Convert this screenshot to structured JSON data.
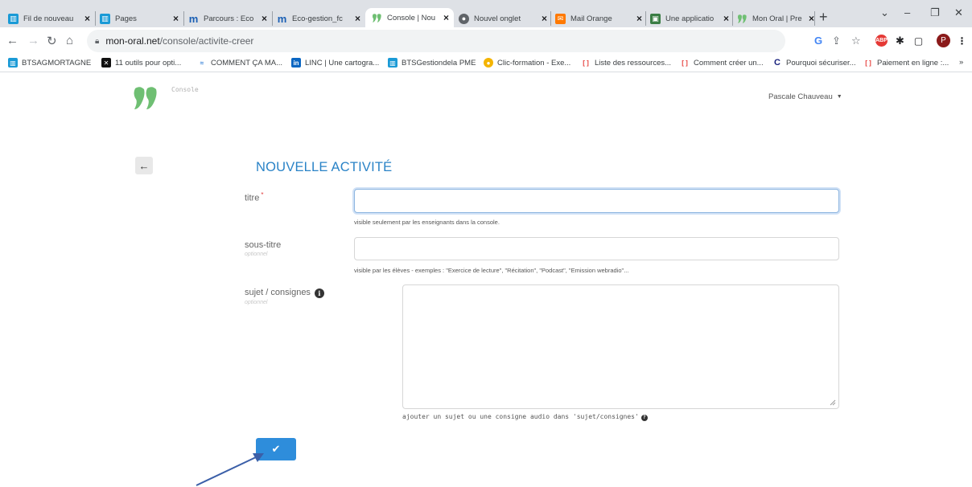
{
  "browser": {
    "tabs": [
      {
        "label": "Fil de nouveau",
        "icon": "linc-icon",
        "active": false
      },
      {
        "label": "Pages",
        "icon": "linc-icon",
        "active": false
      },
      {
        "label": "Parcours : Eco",
        "icon": "m-icon",
        "active": false
      },
      {
        "label": "Eco-gestion_fc",
        "icon": "m-icon",
        "active": false
      },
      {
        "label": "Console | Nou",
        "icon": "mon-oral-icon",
        "active": true
      },
      {
        "label": "Nouvel onglet",
        "icon": "chrome-icon",
        "active": false
      },
      {
        "label": "Mail Orange",
        "icon": "mail-icon",
        "active": false
      },
      {
        "label": "Une applicatio",
        "icon": "app-icon",
        "active": false
      },
      {
        "label": "Mon Oral | Pre",
        "icon": "mon-oral-icon",
        "active": false
      }
    ],
    "new_tab": "+",
    "url_domain": "mon-oral.net",
    "url_path": "/console/activite-creer",
    "profile_initial": "P",
    "bookmarks": [
      {
        "label": "BTSAGMORTAGNE",
        "icon": "linc-icon"
      },
      {
        "label": "11 outils pour opti...",
        "icon": "outil-icon"
      },
      {
        "label": "COMMENT ÇA MA...",
        "icon": "wave-icon"
      },
      {
        "label": "LINC | Une cartogra...",
        "icon": "linkedin-icon"
      },
      {
        "label": "BTSGestiondela PME",
        "icon": "linc-icon"
      },
      {
        "label": "Clic-formation - Exe...",
        "icon": "circle-icon"
      },
      {
        "label": "Liste des ressources...",
        "icon": "bracket-icon"
      },
      {
        "label": "Comment créer un...",
        "icon": "bracket-icon"
      },
      {
        "label": "Pourquoi sécuriser...",
        "icon": "c-icon"
      },
      {
        "label": "Paiement en ligne :...",
        "icon": "bracket-icon"
      }
    ],
    "more_bookmarks": "»"
  },
  "app": {
    "console_label": "Console",
    "user_name": "Pascale Chauveau",
    "page_title": "NOUVELLE ACTIVITÉ",
    "back_icon": "←",
    "fields": {
      "titre": {
        "label": "titre",
        "required_mark": "*",
        "value": "",
        "help": "visible seulement par les enseignants dans la console."
      },
      "sous_titre": {
        "label": "sous-titre",
        "optional": "optionnel",
        "value": "",
        "help": "visible par les élèves - exemples : \"Exercice de lecture\", \"Récitation\", \"Podcast\", \"Emission webradio\"..."
      },
      "sujet": {
        "label": "sujet / consignes",
        "optional": "optionnel",
        "value": "",
        "help": "ajouter un sujet ou une consigne audio dans 'sujet/consignes'"
      }
    },
    "submit_icon": "✔"
  },
  "colors": {
    "accent": "#2e8ddb",
    "title": "#2a83c7",
    "logo": "#6fbf73",
    "required": "#e03b3b"
  }
}
